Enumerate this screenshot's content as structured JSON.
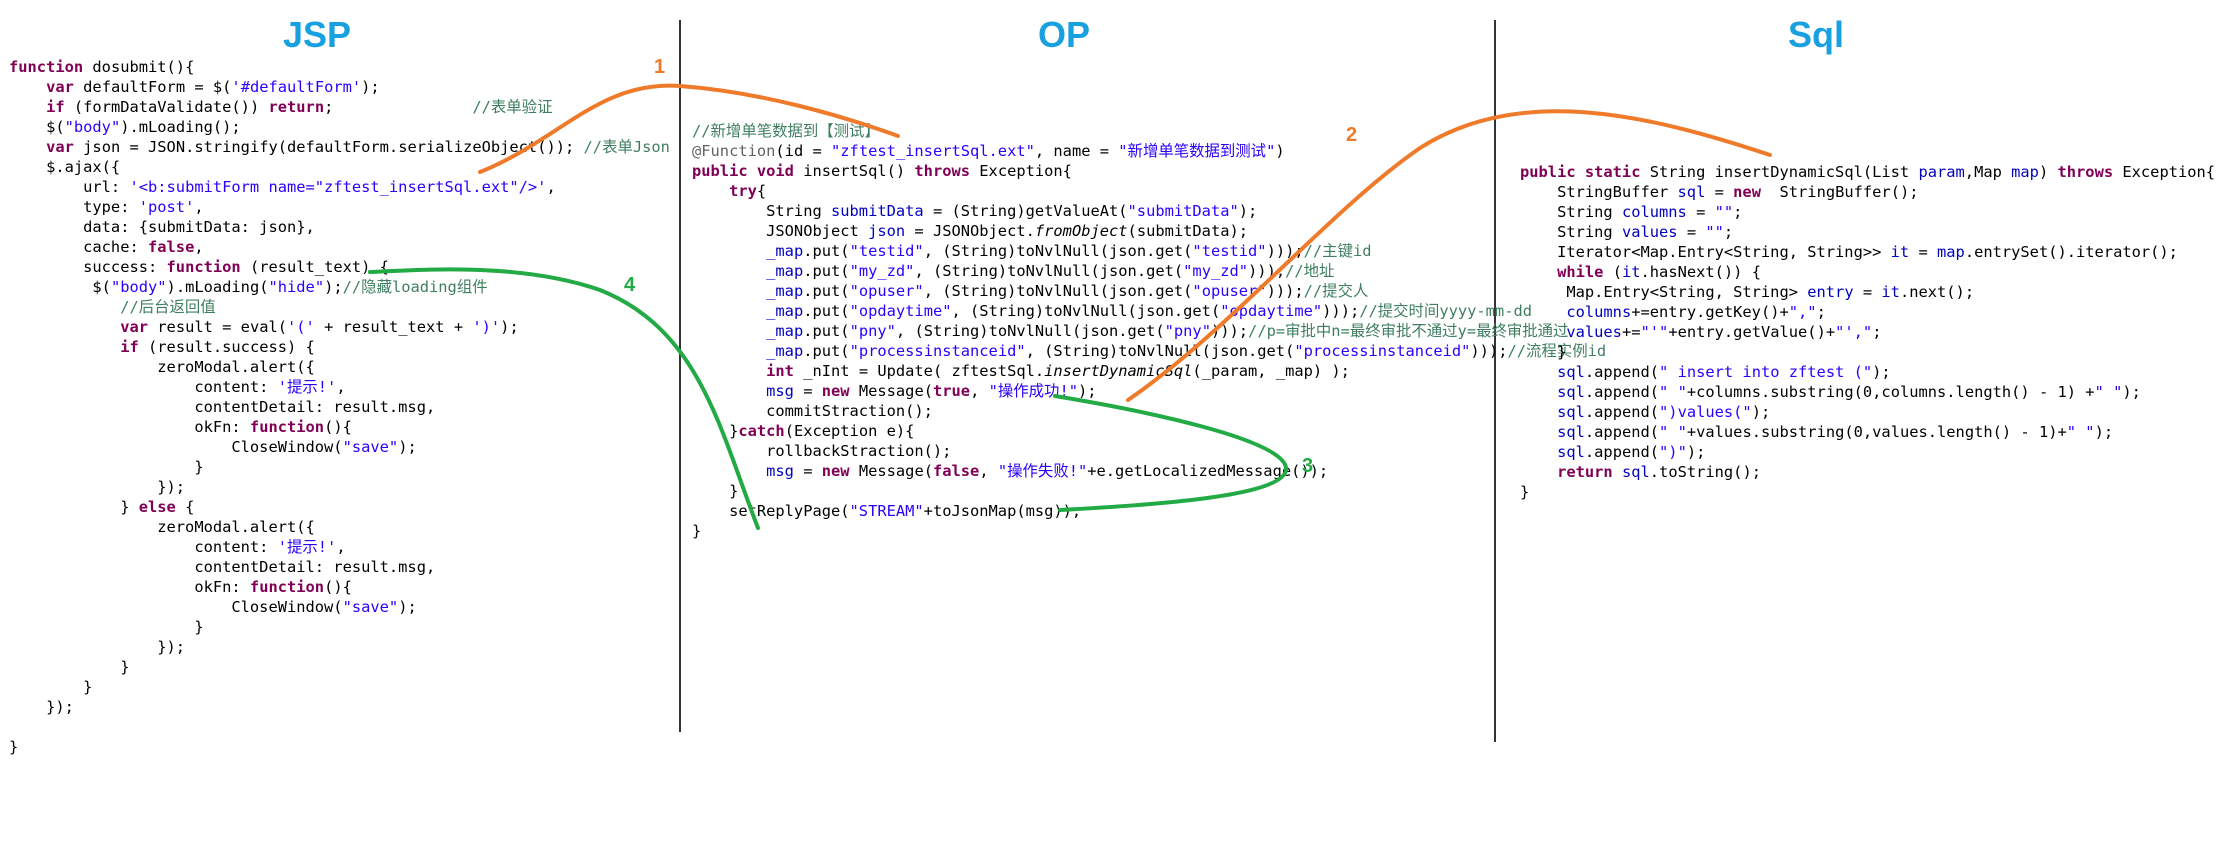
{
  "titles": {
    "jsp": "JSP",
    "op": "OP",
    "sql": "Sql"
  },
  "colors": {
    "title": "#18a0e0",
    "orange": "#ee7a2a",
    "green": "#22aa44",
    "keyword": "#7f0055",
    "string": "#2a00ff",
    "comment": "#3f7f5f"
  },
  "step_labels": {
    "s1": "1",
    "s2": "2",
    "s3": "3",
    "s4": "4"
  },
  "jsp_code": [
    [
      [
        "kw",
        "function"
      ],
      [
        "t",
        " dosubmit(){"
      ]
    ],
    [
      [
        "t",
        "    "
      ],
      [
        "kw",
        "var"
      ],
      [
        "t",
        " defaultForm = $("
      ],
      [
        "str",
        "'#defaultForm'"
      ],
      [
        "t",
        ");"
      ]
    ],
    [
      [
        "t",
        "    "
      ],
      [
        "kw",
        "if"
      ],
      [
        "t",
        " (formDataValidate()) "
      ],
      [
        "kw",
        "return"
      ],
      [
        "t",
        ";               "
      ],
      [
        "cmt",
        "//表单验证"
      ]
    ],
    [
      [
        "t",
        "    $("
      ],
      [
        "str",
        "\"body\""
      ],
      [
        "t",
        ").mLoading();"
      ]
    ],
    [
      [
        "t",
        "    "
      ],
      [
        "kw",
        "var"
      ],
      [
        "t",
        " json = JSON.stringify(defaultForm.serializeObject()); "
      ],
      [
        "cmt",
        "//表单Json"
      ]
    ],
    [
      [
        "t",
        "    $.ajax({"
      ]
    ],
    [
      [
        "t",
        "        url: "
      ],
      [
        "str",
        "'<b:submitForm name=\"zftest_insertSql.ext\"/>'"
      ],
      [
        "t",
        ","
      ]
    ],
    [
      [
        "t",
        "        type: "
      ],
      [
        "str",
        "'post'"
      ],
      [
        "t",
        ","
      ]
    ],
    [
      [
        "t",
        "        data: {submitData: json},"
      ]
    ],
    [
      [
        "t",
        "        cache: "
      ],
      [
        "kw",
        "false"
      ],
      [
        "t",
        ","
      ]
    ],
    [
      [
        "t",
        "        success: "
      ],
      [
        "kw",
        "function"
      ],
      [
        "t",
        " (result_text) {"
      ]
    ],
    [
      [
        "t",
        "         $("
      ],
      [
        "str",
        "\"body\""
      ],
      [
        "t",
        ").mLoading("
      ],
      [
        "str",
        "\"hide\""
      ],
      [
        "t",
        ");"
      ],
      [
        "cmt",
        "//隐藏loading组件"
      ]
    ],
    [
      [
        "t",
        "            "
      ],
      [
        "cmt",
        "//后台返回值"
      ]
    ],
    [
      [
        "t",
        "            "
      ],
      [
        "kw",
        "var"
      ],
      [
        "t",
        " result = eval("
      ],
      [
        "str",
        "'('"
      ],
      [
        "t",
        " + result_text + "
      ],
      [
        "str",
        "')'"
      ],
      [
        "t",
        ");"
      ]
    ],
    [
      [
        "t",
        "            "
      ],
      [
        "kw",
        "if"
      ],
      [
        "t",
        " (result.success) {"
      ]
    ],
    [
      [
        "t",
        "                zeroModal.alert({"
      ]
    ],
    [
      [
        "t",
        "                    content: "
      ],
      [
        "str",
        "'提示!'"
      ],
      [
        "t",
        ","
      ]
    ],
    [
      [
        "t",
        "                    contentDetail: result.msg,"
      ]
    ],
    [
      [
        "t",
        "                    okFn: "
      ],
      [
        "kw",
        "function"
      ],
      [
        "t",
        "(){"
      ]
    ],
    [
      [
        "t",
        "                        CloseWindow("
      ],
      [
        "str",
        "\"save\""
      ],
      [
        "t",
        ");"
      ]
    ],
    [
      [
        "t",
        "                    }"
      ]
    ],
    [
      [
        "t",
        "                });"
      ]
    ],
    [
      [
        "t",
        "            } "
      ],
      [
        "kw",
        "else"
      ],
      [
        "t",
        " {"
      ]
    ],
    [
      [
        "t",
        "                zeroModal.alert({"
      ]
    ],
    [
      [
        "t",
        "                    content: "
      ],
      [
        "str",
        "'提示!'"
      ],
      [
        "t",
        ","
      ]
    ],
    [
      [
        "t",
        "                    contentDetail: result.msg,"
      ]
    ],
    [
      [
        "t",
        "                    okFn: "
      ],
      [
        "kw",
        "function"
      ],
      [
        "t",
        "(){"
      ]
    ],
    [
      [
        "t",
        "                        CloseWindow("
      ],
      [
        "str",
        "\"save\""
      ],
      [
        "t",
        ");"
      ]
    ],
    [
      [
        "t",
        "                    }"
      ]
    ],
    [
      [
        "t",
        "                });"
      ]
    ],
    [
      [
        "t",
        "            }"
      ]
    ],
    [
      [
        "t",
        "        }"
      ]
    ],
    [
      [
        "t",
        "    });"
      ]
    ],
    [
      [
        "t",
        ""
      ]
    ],
    [
      [
        "t",
        "}"
      ]
    ]
  ],
  "op_code": [
    [
      [
        "cmt",
        "//新增单笔数据到【测试】"
      ]
    ],
    [
      [
        "ann",
        "@Function"
      ],
      [
        "t",
        "(id = "
      ],
      [
        "str",
        "\"zftest_insertSql.ext\""
      ],
      [
        "t",
        ", name = "
      ],
      [
        "str",
        "\"新增单笔数据到测试\""
      ],
      [
        "t",
        ")"
      ]
    ],
    [
      [
        "kw",
        "public void"
      ],
      [
        "t",
        " insertSql() "
      ],
      [
        "kw",
        "throws"
      ],
      [
        "t",
        " Exception{"
      ]
    ],
    [
      [
        "t",
        "    "
      ],
      [
        "kw",
        "try"
      ],
      [
        "t",
        "{"
      ]
    ],
    [
      [
        "t",
        "        String "
      ],
      [
        "fld",
        "submitData"
      ],
      [
        "t",
        " = (String)getValueAt("
      ],
      [
        "str",
        "\"submitData\""
      ],
      [
        "t",
        ");"
      ]
    ],
    [
      [
        "t",
        "        JSONObject "
      ],
      [
        "fld",
        "json"
      ],
      [
        "t",
        " = JSONObject."
      ],
      [
        "it",
        "fromObject"
      ],
      [
        "t",
        "(submitData);"
      ]
    ],
    [
      [
        "t",
        "        "
      ],
      [
        "fld",
        "_map"
      ],
      [
        "t",
        ".put("
      ],
      [
        "str",
        "\"testid\""
      ],
      [
        "t",
        ", (String)toNvlNull(json.get("
      ],
      [
        "str",
        "\"testid\""
      ],
      [
        "t",
        ")));"
      ],
      [
        "cmt",
        "//主键id"
      ]
    ],
    [
      [
        "t",
        "        "
      ],
      [
        "fld",
        "_map"
      ],
      [
        "t",
        ".put("
      ],
      [
        "str",
        "\"my_zd\""
      ],
      [
        "t",
        ", (String)toNvlNull(json.get("
      ],
      [
        "str",
        "\"my_zd\""
      ],
      [
        "t",
        ")));"
      ],
      [
        "cmt",
        "//地址"
      ]
    ],
    [
      [
        "t",
        "        "
      ],
      [
        "fld",
        "_map"
      ],
      [
        "t",
        ".put("
      ],
      [
        "str",
        "\"opuser\""
      ],
      [
        "t",
        ", (String)toNvlNull(json.get("
      ],
      [
        "str",
        "\"opuser\""
      ],
      [
        "t",
        ")));"
      ],
      [
        "cmt",
        "//提交人"
      ]
    ],
    [
      [
        "t",
        "        "
      ],
      [
        "fld",
        "_map"
      ],
      [
        "t",
        ".put("
      ],
      [
        "str",
        "\"opdaytime\""
      ],
      [
        "t",
        ", (String)toNvlNull(json.get("
      ],
      [
        "str",
        "\"opdaytime\""
      ],
      [
        "t",
        ")));"
      ],
      [
        "cmt",
        "//提交时间yyyy-mm-dd"
      ]
    ],
    [
      [
        "t",
        "        "
      ],
      [
        "fld",
        "_map"
      ],
      [
        "t",
        ".put("
      ],
      [
        "str",
        "\"pny\""
      ],
      [
        "t",
        ", (String)toNvlNull(json.get("
      ],
      [
        "str",
        "\"pny\""
      ],
      [
        "t",
        ")));"
      ],
      [
        "cmt",
        "//p=审批中n=最终审批不通过y=最终审批通过"
      ]
    ],
    [
      [
        "t",
        "        "
      ],
      [
        "fld",
        "_map"
      ],
      [
        "t",
        ".put("
      ],
      [
        "str",
        "\"processinstanceid\""
      ],
      [
        "t",
        ", (String)toNvlNull(json.get("
      ],
      [
        "str",
        "\"processinstanceid\""
      ],
      [
        "t",
        ")));"
      ],
      [
        "cmt",
        "//流程实例id"
      ]
    ],
    [
      [
        "t",
        "        "
      ],
      [
        "kw",
        "int"
      ],
      [
        "t",
        " _nInt = Update( zftestSql."
      ],
      [
        "it",
        "insertDynamicSql"
      ],
      [
        "t",
        "(_param, _map) );"
      ]
    ],
    [
      [
        "t",
        "        "
      ],
      [
        "fld",
        "msg"
      ],
      [
        "t",
        " = "
      ],
      [
        "kw",
        "new"
      ],
      [
        "t",
        " Message("
      ],
      [
        "kw",
        "true"
      ],
      [
        "t",
        ", "
      ],
      [
        "str",
        "\"操作成功!\""
      ],
      [
        "t",
        ");"
      ]
    ],
    [
      [
        "t",
        "        commitStraction();"
      ]
    ],
    [
      [
        "t",
        "    }"
      ],
      [
        "kw",
        "catch"
      ],
      [
        "t",
        "(Exception e){"
      ]
    ],
    [
      [
        "t",
        "        rollbackStraction();"
      ]
    ],
    [
      [
        "t",
        "        "
      ],
      [
        "fld",
        "msg"
      ],
      [
        "t",
        " = "
      ],
      [
        "kw",
        "new"
      ],
      [
        "t",
        " Message("
      ],
      [
        "kw",
        "false"
      ],
      [
        "t",
        ", "
      ],
      [
        "str",
        "\"操作失败!\""
      ],
      [
        "t",
        "+e.getLocalizedMessage());"
      ]
    ],
    [
      [
        "t",
        "    }"
      ]
    ],
    [
      [
        "t",
        "    setReplyPage("
      ],
      [
        "str",
        "\"STREAM\""
      ],
      [
        "t",
        "+toJsonMap(msg));"
      ]
    ],
    [
      [
        "t",
        "}"
      ]
    ]
  ],
  "sql_code": [
    [
      [
        "kw",
        "public static"
      ],
      [
        "t",
        " String insertDynamicSql(List "
      ],
      [
        "fld",
        "param"
      ],
      [
        "t",
        ",Map "
      ],
      [
        "fld",
        "map"
      ],
      [
        "t",
        ") "
      ],
      [
        "kw",
        "throws"
      ],
      [
        "t",
        " Exception{"
      ]
    ],
    [
      [
        "t",
        "    StringBuffer "
      ],
      [
        "fld",
        "sql"
      ],
      [
        "t",
        " = "
      ],
      [
        "kw",
        "new"
      ],
      [
        "t",
        "  StringBuffer();"
      ]
    ],
    [
      [
        "t",
        "    String "
      ],
      [
        "fld",
        "columns"
      ],
      [
        "t",
        " = "
      ],
      [
        "str",
        "\"\""
      ],
      [
        "t",
        ";"
      ]
    ],
    [
      [
        "t",
        "    String "
      ],
      [
        "fld",
        "values"
      ],
      [
        "t",
        " = "
      ],
      [
        "str",
        "\"\""
      ],
      [
        "t",
        ";"
      ]
    ],
    [
      [
        "t",
        "    Iterator<Map.Entry<String, String>> "
      ],
      [
        "fld",
        "it"
      ],
      [
        "t",
        " = "
      ],
      [
        "fld",
        "map"
      ],
      [
        "t",
        ".entrySet().iterator();"
      ]
    ],
    [
      [
        "t",
        "    "
      ],
      [
        "kw",
        "while"
      ],
      [
        "t",
        " ("
      ],
      [
        "fld",
        "it"
      ],
      [
        "t",
        ".hasNext()) {"
      ]
    ],
    [
      [
        "t",
        "     Map.Entry<String, String> "
      ],
      [
        "fld",
        "entry"
      ],
      [
        "t",
        " = "
      ],
      [
        "fld",
        "it"
      ],
      [
        "t",
        ".next();"
      ]
    ],
    [
      [
        "t",
        "     "
      ],
      [
        "fld",
        "columns"
      ],
      [
        "t",
        "+=entry.getKey()+"
      ],
      [
        "str",
        "\",\""
      ],
      [
        "t",
        ";"
      ]
    ],
    [
      [
        "t",
        "     "
      ],
      [
        "fld",
        "values"
      ],
      [
        "t",
        "+="
      ],
      [
        "str",
        "\"'\""
      ],
      [
        "t",
        "+entry.getValue()+"
      ],
      [
        "str",
        "\"',\""
      ],
      [
        "t",
        ";"
      ]
    ],
    [
      [
        "t",
        "    }"
      ]
    ],
    [
      [
        "t",
        "    "
      ],
      [
        "fld",
        "sql"
      ],
      [
        "t",
        ".append("
      ],
      [
        "str",
        "\" insert into zftest (\""
      ],
      [
        "t",
        ");"
      ]
    ],
    [
      [
        "t",
        "    "
      ],
      [
        "fld",
        "sql"
      ],
      [
        "t",
        ".append("
      ],
      [
        "str",
        "\" \""
      ],
      [
        "t",
        "+columns.substring(0,columns.length() - 1) +"
      ],
      [
        "str",
        "\" \""
      ],
      [
        "t",
        ");"
      ]
    ],
    [
      [
        "t",
        "    "
      ],
      [
        "fld",
        "sql"
      ],
      [
        "t",
        ".append("
      ],
      [
        "str",
        "\")values(\""
      ],
      [
        "t",
        ");"
      ]
    ],
    [
      [
        "t",
        "    "
      ],
      [
        "fld",
        "sql"
      ],
      [
        "t",
        ".append("
      ],
      [
        "str",
        "\" \""
      ],
      [
        "t",
        "+values.substring(0,values.length() - 1)+"
      ],
      [
        "str",
        "\" \""
      ],
      [
        "t",
        ");"
      ]
    ],
    [
      [
        "t",
        "    "
      ],
      [
        "fld",
        "sql"
      ],
      [
        "t",
        ".append("
      ],
      [
        "str",
        "\")\""
      ],
      [
        "t",
        ");"
      ]
    ],
    [
      [
        "t",
        "    "
      ],
      [
        "kw",
        "return"
      ],
      [
        "t",
        " "
      ],
      [
        "fld",
        "sql"
      ],
      [
        "t",
        ".toString();"
      ]
    ],
    [
      [
        "t",
        "}"
      ]
    ]
  ]
}
